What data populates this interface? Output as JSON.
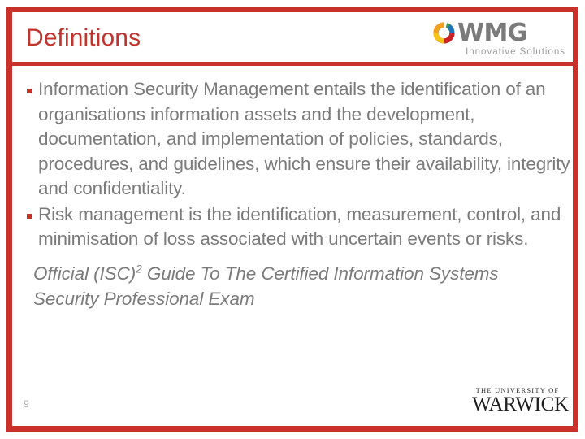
{
  "slide": {
    "title": "Definitions",
    "number": "9",
    "accent_color": "#c0342c",
    "body_text_color": "#7b7b7b"
  },
  "branding": {
    "wmg": {
      "wordmark": "WMG",
      "tagline": "Innovative Solutions",
      "swirl_icon": "wmg-swirl-icon",
      "wordmark_color": "#7a7a7a",
      "tagline_color": "#9c9c9c"
    },
    "warwick": {
      "line1": "THE UNIVERSITY OF",
      "line2": "WARWICK"
    }
  },
  "content": {
    "bullets": [
      "Information Security Management entails the identification of an organisations information assets and the development, documentation, and implementation of policies, standards, procedures, and guidelines, which ensure their availability, integrity and confidentiality.",
      "Risk management is the identification, measurement, control, and minimisation of loss associated with uncertain events or risks."
    ],
    "citation": {
      "before": "Official (ISC)",
      "superscript": "2",
      "after": " Guide To The Certified Information Systems Security Professional Exam"
    }
  }
}
